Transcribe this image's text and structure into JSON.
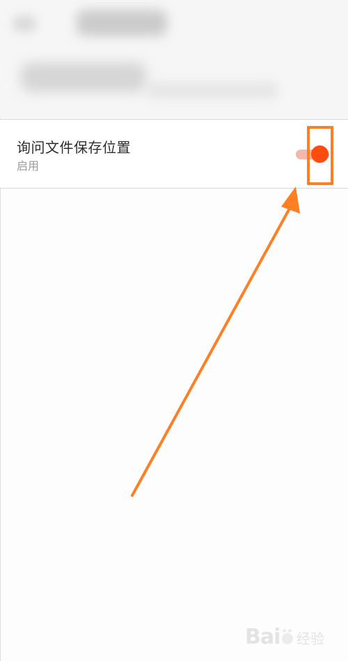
{
  "setting": {
    "title": "询问文件保存位置",
    "subtitle": "启用",
    "enabled": true
  },
  "colors": {
    "accent": "#ff4d0f",
    "toggle_track": "#f4b8aa",
    "annotation": "#ff7f22",
    "text_primary": "#2c2c2c",
    "text_secondary": "#9a9a9a"
  },
  "watermark": {
    "logo_text": "Bai",
    "sub_text": "经验"
  }
}
